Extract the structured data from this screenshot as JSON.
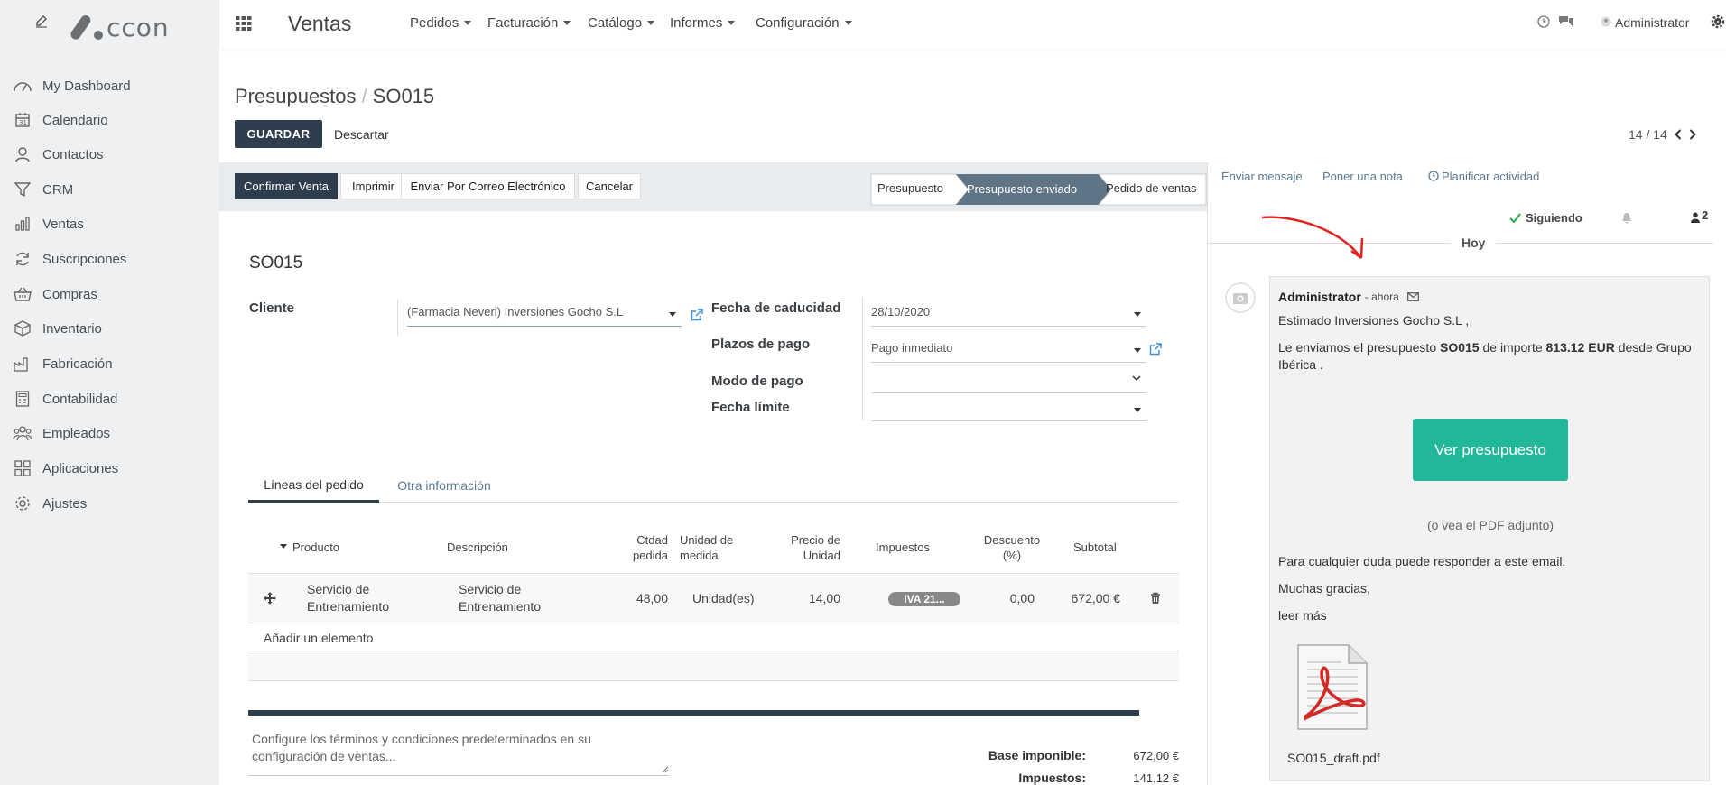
{
  "sidebar": {
    "logo_text": "ccon",
    "items": [
      {
        "label": "My Dashboard"
      },
      {
        "label": "Calendario"
      },
      {
        "label": "Contactos"
      },
      {
        "label": "CRM"
      },
      {
        "label": "Ventas"
      },
      {
        "label": "Suscripciones"
      },
      {
        "label": "Compras"
      },
      {
        "label": "Inventario"
      },
      {
        "label": "Fabricación"
      },
      {
        "label": "Contabilidad"
      },
      {
        "label": "Empleados"
      },
      {
        "label": "Aplicaciones"
      },
      {
        "label": "Ajustes"
      }
    ]
  },
  "topbar": {
    "app_name": "Ventas",
    "menus": [
      {
        "label": "Pedidos"
      },
      {
        "label": "Facturación"
      },
      {
        "label": "Catálogo"
      },
      {
        "label": "Informes"
      },
      {
        "label": "Configuración"
      }
    ],
    "user": "Administrator"
  },
  "control": {
    "breadcrumb_parent": "Presupuestos",
    "breadcrumb_sep": "/",
    "breadcrumb_current": "SO015",
    "save_label": "GUARDAR",
    "discard_label": "Descartar",
    "pager": "14 / 14"
  },
  "statusbar": {
    "buttons": [
      {
        "label": "Confirmar Venta"
      },
      {
        "label": "Imprimir"
      },
      {
        "label": "Enviar Por Correo Electrónico"
      },
      {
        "label": "Cancelar"
      }
    ],
    "stages": [
      {
        "label": "Presupuesto"
      },
      {
        "label": "Presupuesto enviado"
      },
      {
        "label": "Pedido de ventas"
      }
    ]
  },
  "form": {
    "title": "SO015",
    "client_label": "Cliente",
    "client_value": "(Farmacia Neveri) Inversiones Gocho S.L",
    "expiry_label": "Fecha de caducidad",
    "expiry_value": "28/10/2020",
    "terms_label": "Plazos de pago",
    "terms_value": "Pago inmediato",
    "mode_label": "Modo de pago",
    "limit_label": "Fecha límite",
    "tabs": [
      {
        "label": "Líneas del pedido"
      },
      {
        "label": "Otra información"
      }
    ],
    "columns": {
      "product": "Producto",
      "description": "Descripción",
      "qty_1": "Ctdad",
      "qty_2": "pedida",
      "uom_1": "Unidad de",
      "uom_2": "medida",
      "price_1": "Precio de",
      "price_2": "Unidad",
      "taxes": "Impuestos",
      "disc_1": "Descuento",
      "disc_2": "(%)",
      "subtotal": "Subtotal"
    },
    "line": {
      "product_1": "Servicio de",
      "product_2": "Entrenamiento",
      "desc_1": "Servicio de",
      "desc_2": "Entrenamiento",
      "qty": "48,00",
      "uom": "Unidad(es)",
      "price": "14,00",
      "tax": "IVA 21...",
      "discount": "0,00",
      "subtotal": "672,00 €"
    },
    "add_line": "Añadir un elemento",
    "terms_note_1": "Configure los términos y condiciones predeterminados en su",
    "terms_note_2": "configuración de ventas...",
    "base_label": "Base imponible:",
    "base_value": "672,00 €",
    "tax_label": "Impuestos:",
    "tax_value": "141,12 €"
  },
  "chatter": {
    "send_message": "Enviar mensaje",
    "log_note": "Poner una nota",
    "schedule": "Planificar actividad",
    "following": "Siguiendo",
    "followers": "2",
    "day": "Hoy",
    "author": "Administrator",
    "time": "- ahora",
    "greeting": "Estimado Inversiones Gocho S.L ,",
    "body_1a": "Le enviamos el presupuesto ",
    "body_1b": "SO015",
    "body_1c": " de importe ",
    "body_1d": "813.12 EUR",
    "body_1e": " desde Grupo",
    "body_2": "Ibérica .",
    "view_button": "Ver presupuesto",
    "pdf_note": "(o vea el PDF adjunto)",
    "reply_note": "Para cualquier duda puede responder a este email.",
    "thanks": "Muchas gracias,",
    "read_more": "leer más",
    "attachment": "SO015_draft.pdf"
  },
  "colors": {
    "primary": "#2f3e4c",
    "accent": "#21b799",
    "link": "#5b7a93",
    "annotation": "#e0231e"
  }
}
